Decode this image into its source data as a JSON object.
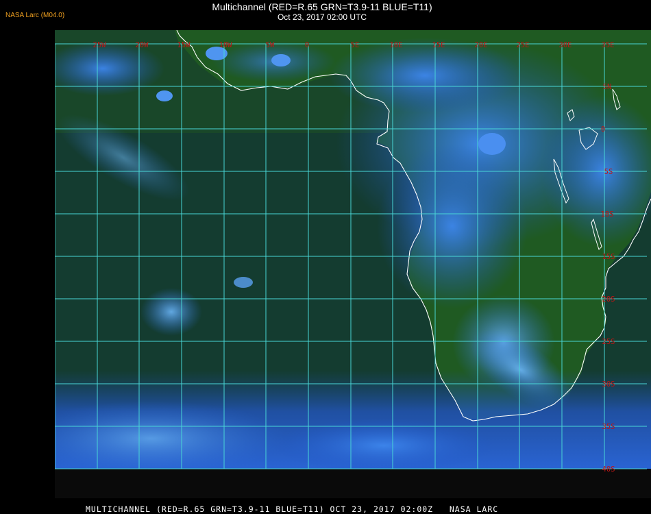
{
  "header": {
    "credit": "NASA Larc (M04.0)",
    "title": "Multichannel (RED=R.65 GRN=T3.9-11 BLUE=T11)",
    "subtitle": "Oct 23, 2017 02:00 UTC"
  },
  "footer": {
    "caption": "MULTICHANNEL (RED=R.65 GRN=T3.9-11 BLUE=T11) OCT 23, 2017 02:00Z   NASA LARC"
  },
  "map": {
    "longitude_labels": [
      "25W",
      "20W",
      "15W",
      "10W",
      "5W",
      "0",
      "5E",
      "10E",
      "15E",
      "20E",
      "25E",
      "30E",
      "35E"
    ],
    "latitude_labels": [
      "5N",
      "0",
      "5S",
      "10S",
      "15S",
      "20S",
      "25S",
      "30S",
      "35S",
      "40S"
    ],
    "colors": {
      "background": "#000000",
      "ocean": "#123a2c",
      "land": "#1d5a20",
      "cloud": "#2f6fe0",
      "cloud_bright": "#5aa8f0",
      "grid": "#49d6d6",
      "label": "#c01414",
      "coastline": "#ffffff"
    }
  }
}
